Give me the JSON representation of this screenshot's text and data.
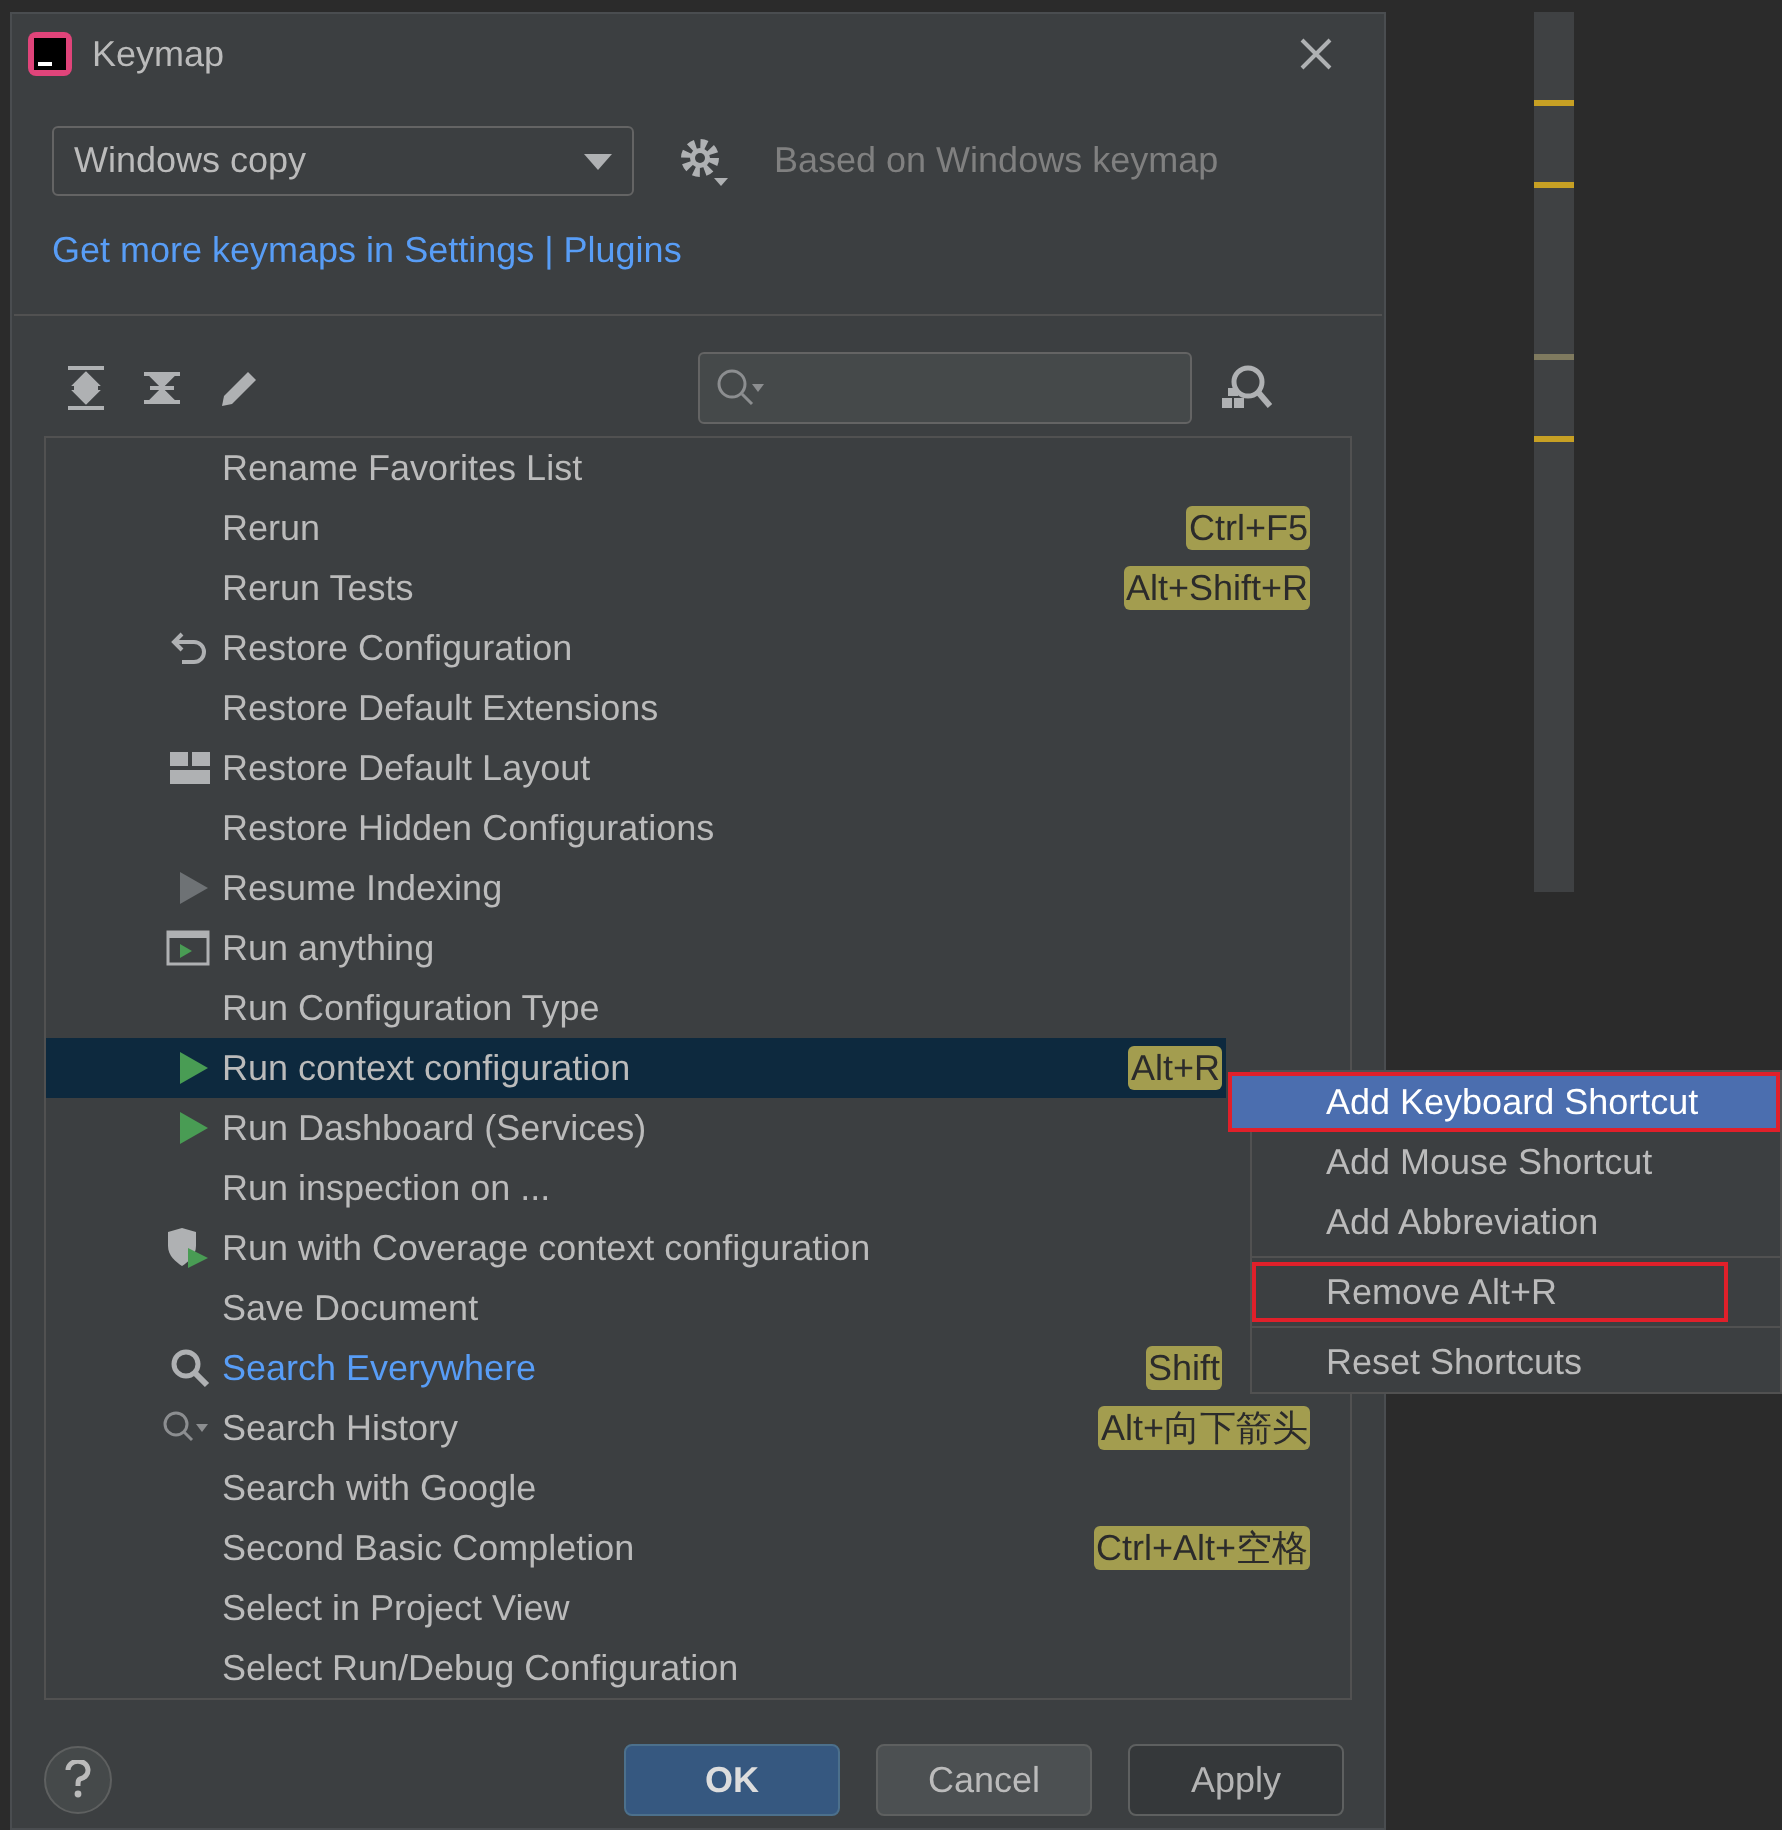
{
  "window": {
    "title": "Keymap"
  },
  "keymap_select": {
    "value": "Windows copy"
  },
  "based_on": "Based on Windows keymap",
  "plugins_link": "Get more keymaps in Settings | Plugins",
  "actions": [
    {
      "label": "Rename Favorites List",
      "kind": "plain",
      "selected": false,
      "highlighted": false
    },
    {
      "label": "Rerun",
      "kind": "plain",
      "selected": false,
      "highlighted": false,
      "shortcut": "Ctrl+F5"
    },
    {
      "label": "Rerun Tests",
      "kind": "plain",
      "selected": false,
      "highlighted": false,
      "shortcut": "Alt+Shift+R"
    },
    {
      "label": "Restore Configuration",
      "kind": "undo",
      "selected": false,
      "highlighted": false
    },
    {
      "label": "Restore Default Extensions",
      "kind": "plain",
      "selected": false,
      "highlighted": false
    },
    {
      "label": "Restore Default Layout",
      "kind": "layout",
      "selected": false,
      "highlighted": false
    },
    {
      "label": "Restore Hidden Configurations",
      "kind": "plain",
      "selected": false,
      "highlighted": false
    },
    {
      "label": "Resume Indexing",
      "kind": "resume",
      "selected": false,
      "highlighted": false
    },
    {
      "label": "Run anything",
      "kind": "run-window",
      "selected": false,
      "highlighted": false
    },
    {
      "label": "Run Configuration Type",
      "kind": "plain",
      "selected": false,
      "highlighted": false
    },
    {
      "label": "Run context configuration",
      "kind": "run",
      "selected": true,
      "highlighted": false,
      "shortcut": "Alt+R",
      "shortcut_covered": true
    },
    {
      "label": "Run Dashboard (Services)",
      "kind": "run",
      "selected": false,
      "highlighted": false
    },
    {
      "label": "Run inspection on ...",
      "kind": "plain",
      "selected": false,
      "highlighted": false
    },
    {
      "label": "Run with Coverage context configuration",
      "kind": "coverage",
      "selected": false,
      "highlighted": false
    },
    {
      "label": "Save Document",
      "kind": "plain",
      "selected": false,
      "highlighted": false
    },
    {
      "label": "Search Everywhere",
      "kind": "search",
      "selected": false,
      "highlighted": true,
      "shortcut": "Shift",
      "shortcut_covered": true
    },
    {
      "label": "Search History",
      "kind": "search-history",
      "selected": false,
      "highlighted": false,
      "shortcut": "Alt+向下箭头"
    },
    {
      "label": "Search with Google",
      "kind": "plain",
      "selected": false,
      "highlighted": false
    },
    {
      "label": "Second Basic Completion",
      "kind": "plain",
      "selected": false,
      "highlighted": false,
      "shortcut": "Ctrl+Alt+空格"
    },
    {
      "label": "Select in Project View",
      "kind": "plain",
      "selected": false,
      "highlighted": false
    },
    {
      "label": "Select Run/Debug Configuration",
      "kind": "plain",
      "selected": false,
      "highlighted": false
    }
  ],
  "context_menu": [
    {
      "label": "Add Keyboard Shortcut",
      "selected": true,
      "outlined": true,
      "separator_after": false
    },
    {
      "label": "Add Mouse Shortcut",
      "selected": false,
      "outlined": false,
      "separator_after": false
    },
    {
      "label": "Add Abbreviation",
      "selected": false,
      "outlined": false,
      "separator_after": true
    },
    {
      "label": "Remove Alt+R",
      "selected": false,
      "outlined": true,
      "separator_after": true
    },
    {
      "label": "Reset Shortcuts",
      "selected": false,
      "outlined": false,
      "separator_after": false
    }
  ],
  "buttons": [
    {
      "label": "OK",
      "default": true,
      "disabled": false
    },
    {
      "label": "Cancel",
      "default": false,
      "disabled": false
    },
    {
      "label": "Apply",
      "default": false,
      "disabled": true
    }
  ]
}
